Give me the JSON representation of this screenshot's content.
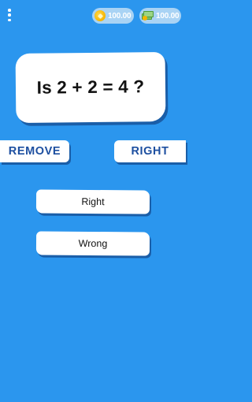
{
  "header": {
    "menu_icon": "more-vertical-icon",
    "coins": {
      "icon": "coin-icon",
      "value": "100.00"
    },
    "cash": {
      "icon": "cash-icon",
      "value": "100.00"
    }
  },
  "question": {
    "text": "Is 2 + 2 = 4 ?"
  },
  "actions": {
    "remove_label": "REMOVE",
    "right_label": "RIGHT"
  },
  "answers": [
    {
      "label": "Right"
    },
    {
      "label": "Wrong"
    }
  ],
  "colors": {
    "background": "#2b96ee",
    "card": "#ffffff",
    "shadow": "#1a5ea8",
    "action_text": "#1d4fa0",
    "pill": "#a9d3f4"
  }
}
